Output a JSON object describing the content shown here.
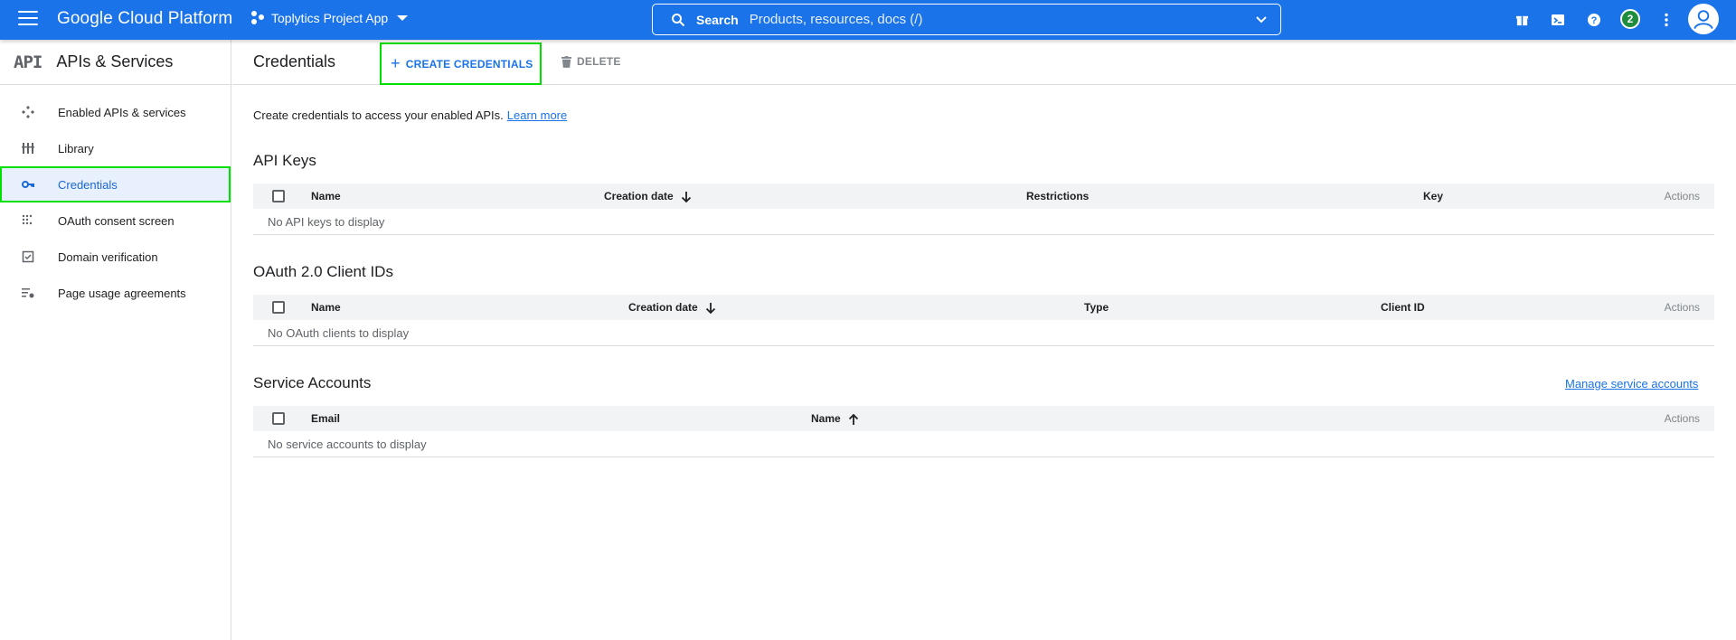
{
  "topbar": {
    "brand": "Google Cloud Platform",
    "project": "Toplytics Project App",
    "search_label": "Search",
    "search_placeholder": "Products, resources, docs (/)",
    "notification_count": "2",
    "icons": [
      "gift-icon",
      "terminal-icon",
      "help-icon",
      "more-vert-icon",
      "account-icon"
    ]
  },
  "sidebar": {
    "logo": "API",
    "title": "APIs & Services",
    "items": [
      {
        "label": "Enabled APIs & services",
        "icon": "api-hub-icon"
      },
      {
        "label": "Library",
        "icon": "library-icon"
      },
      {
        "label": "Credentials",
        "icon": "key-icon",
        "active": true
      },
      {
        "label": "OAuth consent screen",
        "icon": "consent-icon"
      },
      {
        "label": "Domain verification",
        "icon": "checkbox-icon"
      },
      {
        "label": "Page usage agreements",
        "icon": "settings-list-icon"
      }
    ]
  },
  "header": {
    "title": "Credentials",
    "create_label": "CREATE CREDENTIALS",
    "delete_label": "DELETE"
  },
  "intro": {
    "text": "Create credentials to access your enabled APIs.",
    "link": "Learn more"
  },
  "api_keys": {
    "title": "API Keys",
    "columns": [
      "Name",
      "Creation date",
      "Restrictions",
      "Key",
      "Actions"
    ],
    "empty": "No API keys to display"
  },
  "oauth": {
    "title": "OAuth 2.0 Client IDs",
    "columns": [
      "Name",
      "Creation date",
      "Type",
      "Client ID",
      "Actions"
    ],
    "empty": "No OAuth clients to display"
  },
  "service_accounts": {
    "title": "Service Accounts",
    "manage_link": "Manage service accounts",
    "columns": [
      "Email",
      "Name",
      "Actions"
    ],
    "empty": "No service accounts to display"
  },
  "colors": {
    "brand_blue": "#1a73e8",
    "highlight_green": "#00e000",
    "active_bg": "#e8f0fe"
  }
}
